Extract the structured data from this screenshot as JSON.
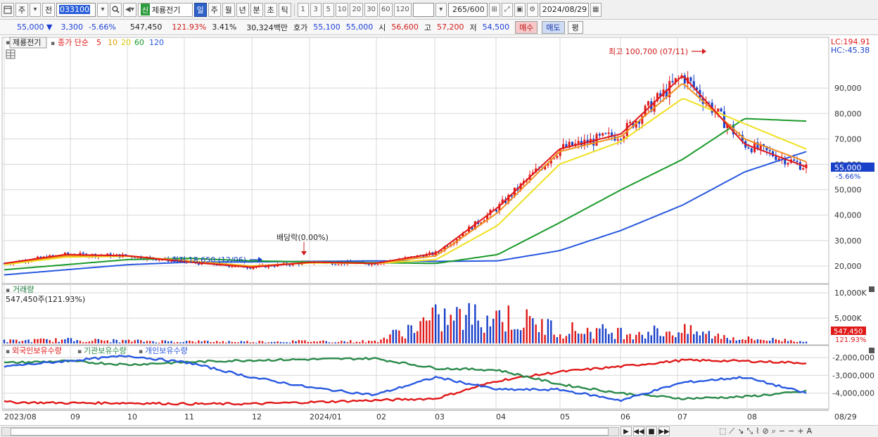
{
  "toolbar": {
    "mode_label": "주",
    "prev_label": "전",
    "code": "033100",
    "stock_tag": "신",
    "stock_name": "제룡전기",
    "periods": [
      "일",
      "주",
      "월",
      "년",
      "분",
      "초",
      "틱"
    ],
    "active_period": "일",
    "intervals": [
      "1",
      "3",
      "5",
      "10",
      "20",
      "30",
      "60",
      "120"
    ],
    "count": "265",
    "count_total": "/600",
    "date": "2024/08/29"
  },
  "quote": {
    "price": "55,000",
    "change": "3,300",
    "change_pct": "-5.66%",
    "volume": "547,450",
    "volume_ratio": "121.93%",
    "turnover": "3.41%",
    "amount": "30,324백만",
    "bid_label": "호가",
    "bid1": "55,100",
    "bid2": "55,000",
    "open_label": "시",
    "open": "56,600",
    "high_label": "고",
    "high": "57,200",
    "low_label": "저",
    "low": "54,500",
    "buy_label": "매수",
    "sell_label": "매도",
    "eval_label": "평"
  },
  "price_panel": {
    "name_tag": "제룡전기",
    "legend_prefix": "종가 단순",
    "ma_periods": [
      "5",
      "10",
      "20",
      "60",
      "120"
    ],
    "lc_label": "LC:194.91",
    "hc_label": "HC:-45.38",
    "y_ticks": [
      "90,000",
      "80,000",
      "70,000",
      "60,000",
      "50,000",
      "40,000",
      "30,000",
      "20,000"
    ],
    "current_price_label": "55,000",
    "current_pct_label": "-5.66%",
    "high_annotation": "최고 100,700 (07/11)",
    "low_annotation": "최저 18,650 (12/06)",
    "dividend_annotation": "배당락(0.00%)"
  },
  "volume_panel": {
    "title": "거래량",
    "value_label": "547,450주(121.93%)",
    "y_ticks": [
      "10,000K",
      "5,000K"
    ],
    "current_label": "547,450",
    "current_pct": "121.93%"
  },
  "holding_panel": {
    "legend": [
      "외국인보유수량",
      "기관보유수량",
      "개인보유수량"
    ],
    "y_ticks": [
      "-2,000,000",
      "-3,000,000",
      "-4,000,000"
    ]
  },
  "x_axis": {
    "labels": [
      "2023/08",
      "09",
      "10",
      "11",
      "12",
      "2024/01",
      "02",
      "03",
      "04",
      "05",
      "06",
      "07",
      "08",
      "08/29"
    ]
  },
  "colors": {
    "ma5": "#e01818",
    "ma10": "#f09020",
    "ma20": "#f0e020",
    "ma60": "#1a9a2a",
    "ma120": "#2858e0",
    "up_candle": "#e01818",
    "down_candle": "#1840c8",
    "foreign": "#e01818",
    "institution": "#2a8a4a",
    "individual": "#2858e0"
  },
  "chart_data": [
    {
      "type": "line",
      "title": "",
      "x": [
        "2023/08",
        "09",
        "10",
        "11",
        "12",
        "2024/01",
        "02",
        "03",
        "04",
        "05",
        "06",
        "07",
        "08",
        "08/29"
      ],
      "series": [
        {
          "name": "5",
          "values": [
            21000,
            24500,
            24000,
            21500,
            19500,
            21500,
            21000,
            25000,
            43000,
            66000,
            72000,
            95000,
            68000,
            59000
          ]
        },
        {
          "name": "10",
          "values": [
            21000,
            24000,
            24000,
            21800,
            19800,
            21500,
            21000,
            24000,
            41000,
            65000,
            71000,
            92000,
            70000,
            61000
          ]
        },
        {
          "name": "20",
          "values": [
            20500,
            23500,
            23800,
            22000,
            20000,
            21200,
            21000,
            22500,
            36000,
            60000,
            69000,
            86000,
            76000,
            66000
          ]
        },
        {
          "name": "60",
          "values": [
            18500,
            20500,
            22500,
            23000,
            22000,
            21600,
            21300,
            21000,
            24500,
            37000,
            50000,
            62000,
            78000,
            77000
          ]
        },
        {
          "name": "120",
          "values": [
            16500,
            18500,
            20500,
            21500,
            21600,
            21800,
            22000,
            21800,
            22000,
            26000,
            34000,
            44000,
            57000,
            65000
          ]
        }
      ],
      "ylim": [
        15000,
        105000
      ],
      "annotations": [
        "최고 100,700 (07/11)",
        "최저 18,650 (12/06)",
        "배당락(0.00%)"
      ]
    },
    {
      "type": "bar",
      "title": "거래량",
      "categories": [
        "2023/08",
        "09",
        "10",
        "11",
        "12",
        "2024/01",
        "02",
        "03",
        "04",
        "05",
        "06",
        "07",
        "08",
        "08/29"
      ],
      "values": [
        500,
        700,
        500,
        400,
        350,
        450,
        400,
        4800,
        5500,
        2800,
        2200,
        2400,
        900,
        547
      ],
      "ylim": [
        0,
        11000
      ]
    },
    {
      "type": "line",
      "title": "",
      "x": [
        "2023/08",
        "09",
        "10",
        "11",
        "12",
        "2024/01",
        "02",
        "03",
        "04",
        "05",
        "06",
        "07",
        "08",
        "08/29"
      ],
      "series": [
        {
          "name": "외국인보유수량",
          "values": [
            -4500000,
            -4550000,
            -4550000,
            -4600000,
            -4600000,
            -4500000,
            -4400000,
            -4300000,
            -3300000,
            -2800000,
            -2500000,
            -2150000,
            -2200000,
            -2300000
          ]
        },
        {
          "name": "기관보유수량",
          "values": [
            -2300000,
            -2200000,
            -2400000,
            -2250000,
            -2150000,
            -2100000,
            -2050000,
            -2600000,
            -2700000,
            -3500000,
            -4000000,
            -4300000,
            -4200000,
            -3900000
          ]
        },
        {
          "name": "개인보유수량",
          "values": [
            -2500000,
            -2200000,
            -1900000,
            -2300000,
            -3100000,
            -3700000,
            -4100000,
            -3100000,
            -3800000,
            -3800000,
            -4400000,
            -3400000,
            -3100000,
            -4000000
          ]
        }
      ],
      "ylim": [
        -4800000,
        -1800000
      ]
    }
  ]
}
